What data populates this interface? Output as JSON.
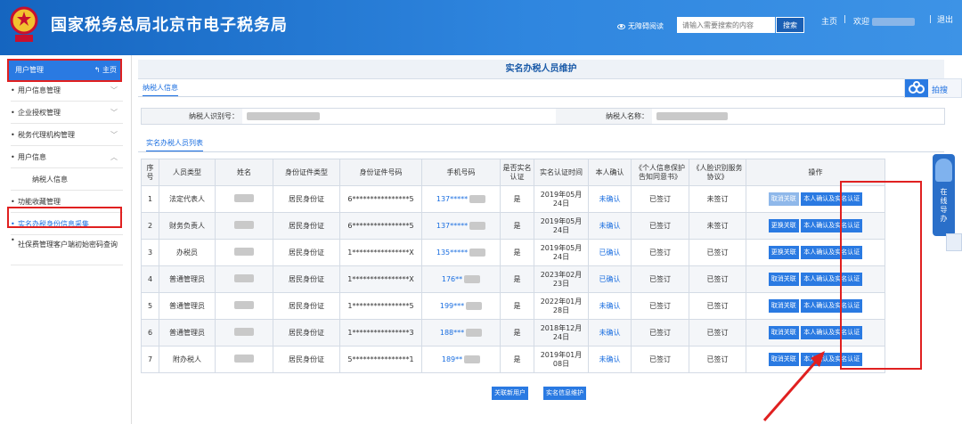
{
  "header": {
    "title": "国家税务总局北京市电子税务局",
    "accessibility": "无障碍阅读",
    "search_placeholder": "请输入需要搜索的内容",
    "search_button": "搜索",
    "home": "主页",
    "welcome": "欢迎",
    "logout": "退出"
  },
  "sidebar": {
    "header": "用户管理",
    "home": "主页",
    "items": [
      {
        "label": "用户信息管理"
      },
      {
        "label": "企业授权管理"
      },
      {
        "label": "税务代理机构管理"
      },
      {
        "label": "用户信息"
      },
      {
        "label": "纳税人信息"
      },
      {
        "label": "功能收藏管理"
      },
      {
        "label": "实名办税身份信息采集"
      },
      {
        "label": "社保费管理客户端初始密码查询"
      }
    ]
  },
  "main": {
    "title": "实名办税人员维护",
    "tab_taxpayer": "纳税人信息",
    "taxpayer_id_label": "纳税人识别号：",
    "taxpayer_name_label": "纳税人名称：",
    "tab_list": "实名办税人员列表",
    "columns": [
      "序号",
      "人员类型",
      "姓名",
      "身份证件类型",
      "身份证件号码",
      "手机号码",
      "是否实名认证",
      "实名认证时间",
      "本人确认",
      "《个人信息保护告知同意书》",
      "《人脸识别服务协议》",
      "操作"
    ],
    "rows": [
      {
        "no": "1",
        "type": "法定代表人",
        "id_type": "居民身份证",
        "id_no": "6****************5",
        "phone": "137*****",
        "verified": "是",
        "time": "2019年05月24日",
        "confirm": "未确认",
        "privacy": "已签订",
        "face": "未签订",
        "op1": "取消关联",
        "op2": "本人确认及实名认证"
      },
      {
        "no": "2",
        "type": "财务负责人",
        "id_type": "居民身份证",
        "id_no": "6****************5",
        "phone": "137*****",
        "verified": "是",
        "time": "2019年05月24日",
        "confirm": "未确认",
        "privacy": "已签订",
        "face": "未签订",
        "op1": "更换关联",
        "op2": "本人确认及实名认证"
      },
      {
        "no": "3",
        "type": "办税员",
        "id_type": "居民身份证",
        "id_no": "1****************X",
        "phone": "135*****",
        "verified": "是",
        "time": "2019年05月24日",
        "confirm": "已确认",
        "privacy": "已签订",
        "face": "已签订",
        "op1": "更换关联",
        "op2": "本人确认及实名认证"
      },
      {
        "no": "4",
        "type": "普通管理员",
        "id_type": "居民身份证",
        "id_no": "1****************X",
        "phone": "176**",
        "verified": "是",
        "time": "2023年02月23日",
        "confirm": "已确认",
        "privacy": "已签订",
        "face": "已签订",
        "op1": "取消关联",
        "op2": "本人确认及实名认证"
      },
      {
        "no": "5",
        "type": "普通管理员",
        "id_type": "居民身份证",
        "id_no": "1****************5",
        "phone": "199***",
        "verified": "是",
        "time": "2022年01月28日",
        "confirm": "未确认",
        "privacy": "已签订",
        "face": "已签订",
        "op1": "取消关联",
        "op2": "本人确认及实名认证"
      },
      {
        "no": "6",
        "type": "普通管理员",
        "id_type": "居民身份证",
        "id_no": "1****************3",
        "phone": "188***",
        "verified": "是",
        "time": "2018年12月24日",
        "confirm": "未确认",
        "privacy": "已签订",
        "face": "已签订",
        "op1": "取消关联",
        "op2": "本人确认及实名认证"
      },
      {
        "no": "7",
        "type": "附办税人",
        "id_type": "居民身份证",
        "id_no": "5****************1",
        "phone": "189**",
        "verified": "是",
        "time": "2019年01月08日",
        "confirm": "未确认",
        "privacy": "已签订",
        "face": "已签订",
        "op1": "取消关联",
        "op2": "本人确认及实名认证"
      }
    ],
    "btn_associate": "关联新用户",
    "btn_maintain": "实名信息维护"
  },
  "floaters": {
    "share": "拍搜",
    "guide": "在线导办"
  },
  "colors": {
    "accent": "#2a7ae2",
    "highlight": "#e02020"
  }
}
